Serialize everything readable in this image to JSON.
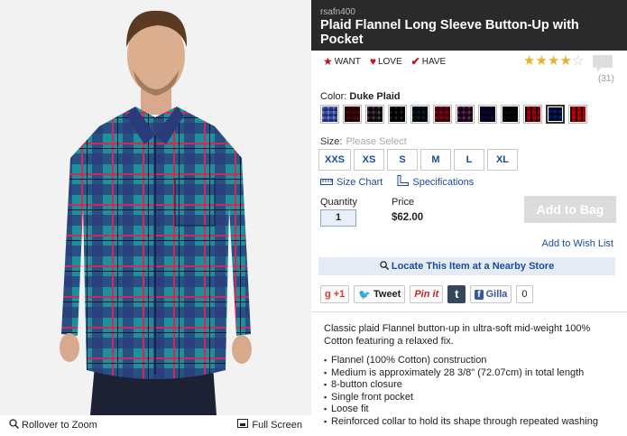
{
  "image": {
    "alt_desc": "product-photo",
    "footer": {
      "zoom_label": "Rollover to Zoom",
      "fullscreen_label": "Full Screen"
    }
  },
  "product": {
    "sku": "rsafn400",
    "title": "Plaid Flannel Long Sleeve Button-Up with Pocket",
    "social": {
      "want": "WANT",
      "love": "LOVE",
      "have": "HAVE"
    },
    "rating": {
      "stars": 4,
      "max": 5,
      "review_count": "(31)"
    },
    "color": {
      "label": "Color:",
      "selected": "Duke Plaid"
    },
    "swatches": [
      {
        "c1": "#7d8fc7",
        "c2": "#dfe3f3"
      },
      {
        "c1": "#8a1a28",
        "c2": "#3c4b8a"
      },
      {
        "c1": "#5a4a5a",
        "c2": "#d8c8d0"
      },
      {
        "c1": "#2a2a2a",
        "c2": "#e0e0e0"
      },
      {
        "c1": "#1a3a4a",
        "c2": "#3a9a8a"
      },
      {
        "c1": "#9a1a3a",
        "c2": "#c85a8a"
      },
      {
        "c1": "#6a3a6a",
        "c2": "#e0d0e0"
      },
      {
        "c1": "#2a2a6a",
        "c2": "#5a2a8a"
      },
      {
        "c1": "#2a2a2a",
        "c2": "#7a1a1a"
      },
      {
        "c1": "#c81a2a",
        "c2": "#2a2a4a"
      },
      {
        "c1": "#2a3a8a",
        "c2": "#1aa0a0"
      },
      {
        "c1": "#d81a1a",
        "c2": "#3a1a1a"
      }
    ],
    "selected_swatch_index": 10,
    "size": {
      "label": "Size:",
      "placeholder": "Please Select",
      "options": [
        "XXS",
        "XS",
        "S",
        "M",
        "L",
        "XL"
      ]
    },
    "size_chart_label": "Size Chart",
    "specifications_label": "Specifications",
    "quantity": {
      "label": "Quantity",
      "value": "1"
    },
    "price": {
      "label": "Price",
      "value": "$62.00"
    },
    "add_to_bag": "Add to Bag",
    "add_to_wishlist": "Add to Wish List",
    "locate_store": "Locate This Item at a Nearby Store",
    "share": {
      "gplus": "+1",
      "tweet": "Tweet",
      "pinit": "Pin it",
      "tumblr": "t",
      "fb_like": "Gilla",
      "fb_count": "0"
    },
    "description": {
      "intro": "Classic plaid Flannel button-up in ultra-soft mid-weight 100% Cotton featuring a relaxed fix.",
      "bullets": [
        "Flannel (100% Cotton) construction",
        "Medium is approximately 28 3/8\" (72.07cm) in total length",
        "8-button closure",
        "Single front pocket",
        "Loose fit",
        "Reinforced collar to hold its shape through repeated washing"
      ]
    }
  },
  "colors": {
    "title_bar": "#2a2a2a",
    "link": "#1a4b9b",
    "accent_red": "#c0121c",
    "star": "#e9b22a"
  }
}
